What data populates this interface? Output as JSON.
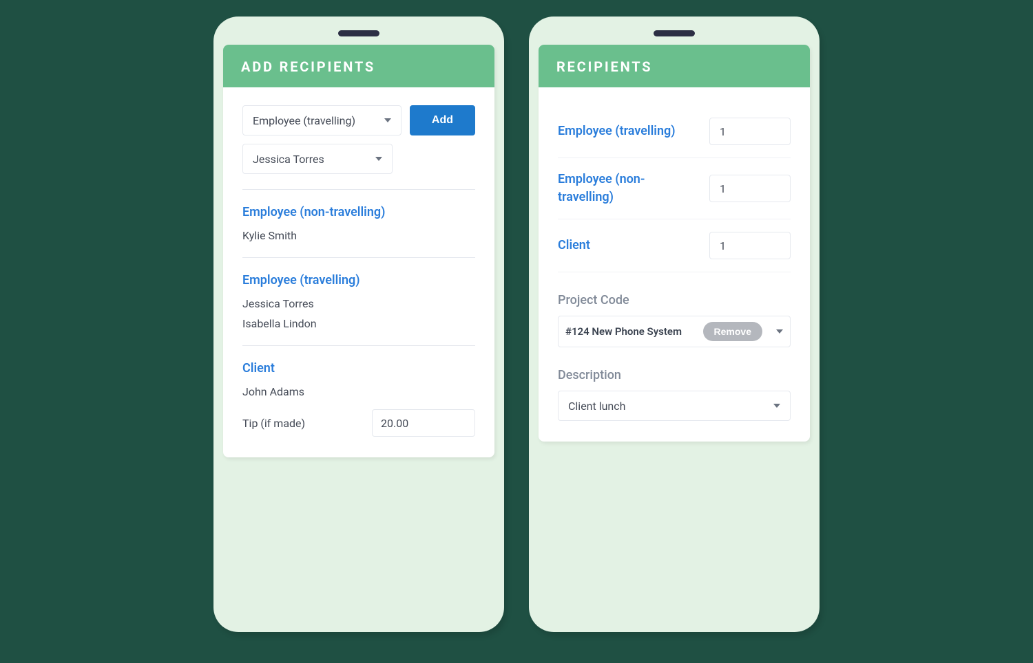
{
  "left": {
    "header": "ADD RECIPIENTS",
    "type_select": "Employee (travelling)",
    "person_select": "Jessica Torres",
    "add_label": "Add",
    "sections": {
      "non_travelling": {
        "title": "Employee (non-travelling)",
        "names": [
          "Kylie Smith"
        ]
      },
      "travelling": {
        "title": "Employee (travelling)",
        "names": [
          "Jessica Torres",
          "Isabella Lindon"
        ]
      },
      "client": {
        "title": "Client",
        "names": [
          "John Adams"
        ]
      }
    },
    "tip_label": "Tip (if made)",
    "tip_value": "20.00"
  },
  "right": {
    "header": "RECIPIENTS",
    "counts": [
      {
        "label": "Employee (travelling)",
        "value": "1"
      },
      {
        "label": "Employee (non-travelling)",
        "value": "1"
      },
      {
        "label": "Client",
        "value": "1"
      }
    ],
    "project_code_label": "Project Code",
    "project_code_value": "#124 New Phone System",
    "remove_label": "Remove",
    "description_label": "Description",
    "description_value": "Client lunch"
  }
}
